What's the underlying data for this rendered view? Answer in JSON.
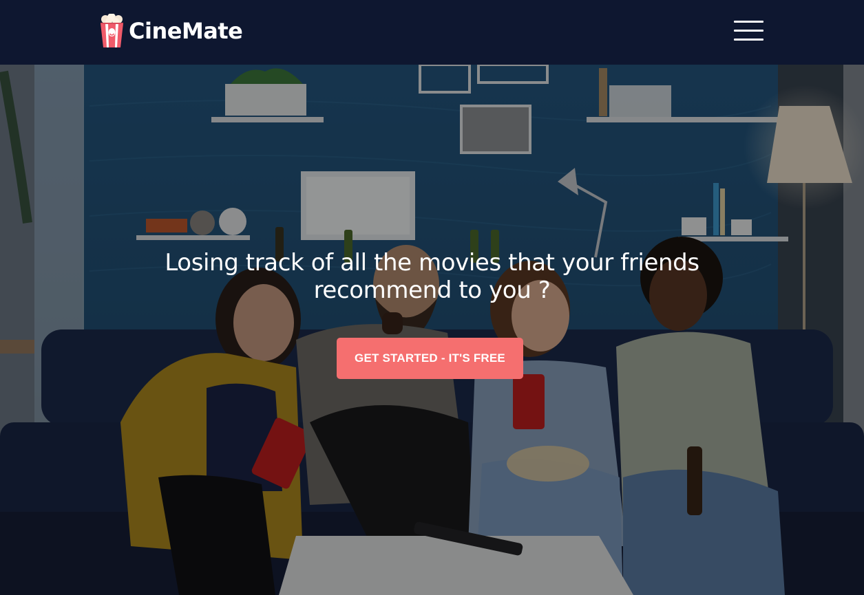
{
  "navbar": {
    "brand_name": "CineMate",
    "logo_icon": "popcorn-bucket-icon",
    "menu_icon": "hamburger-menu-icon"
  },
  "hero": {
    "title_line1": "Losing track of all the movies that your friends",
    "title_line2": "recommend to you ?",
    "cta_label": "GET STARTED - IT'S FREE",
    "image_subject": "friends laughing on a couch in a living room"
  },
  "colors": {
    "navbar_bg": "#0e1730",
    "cta_bg": "#f56f6f",
    "text": "#ffffff"
  }
}
